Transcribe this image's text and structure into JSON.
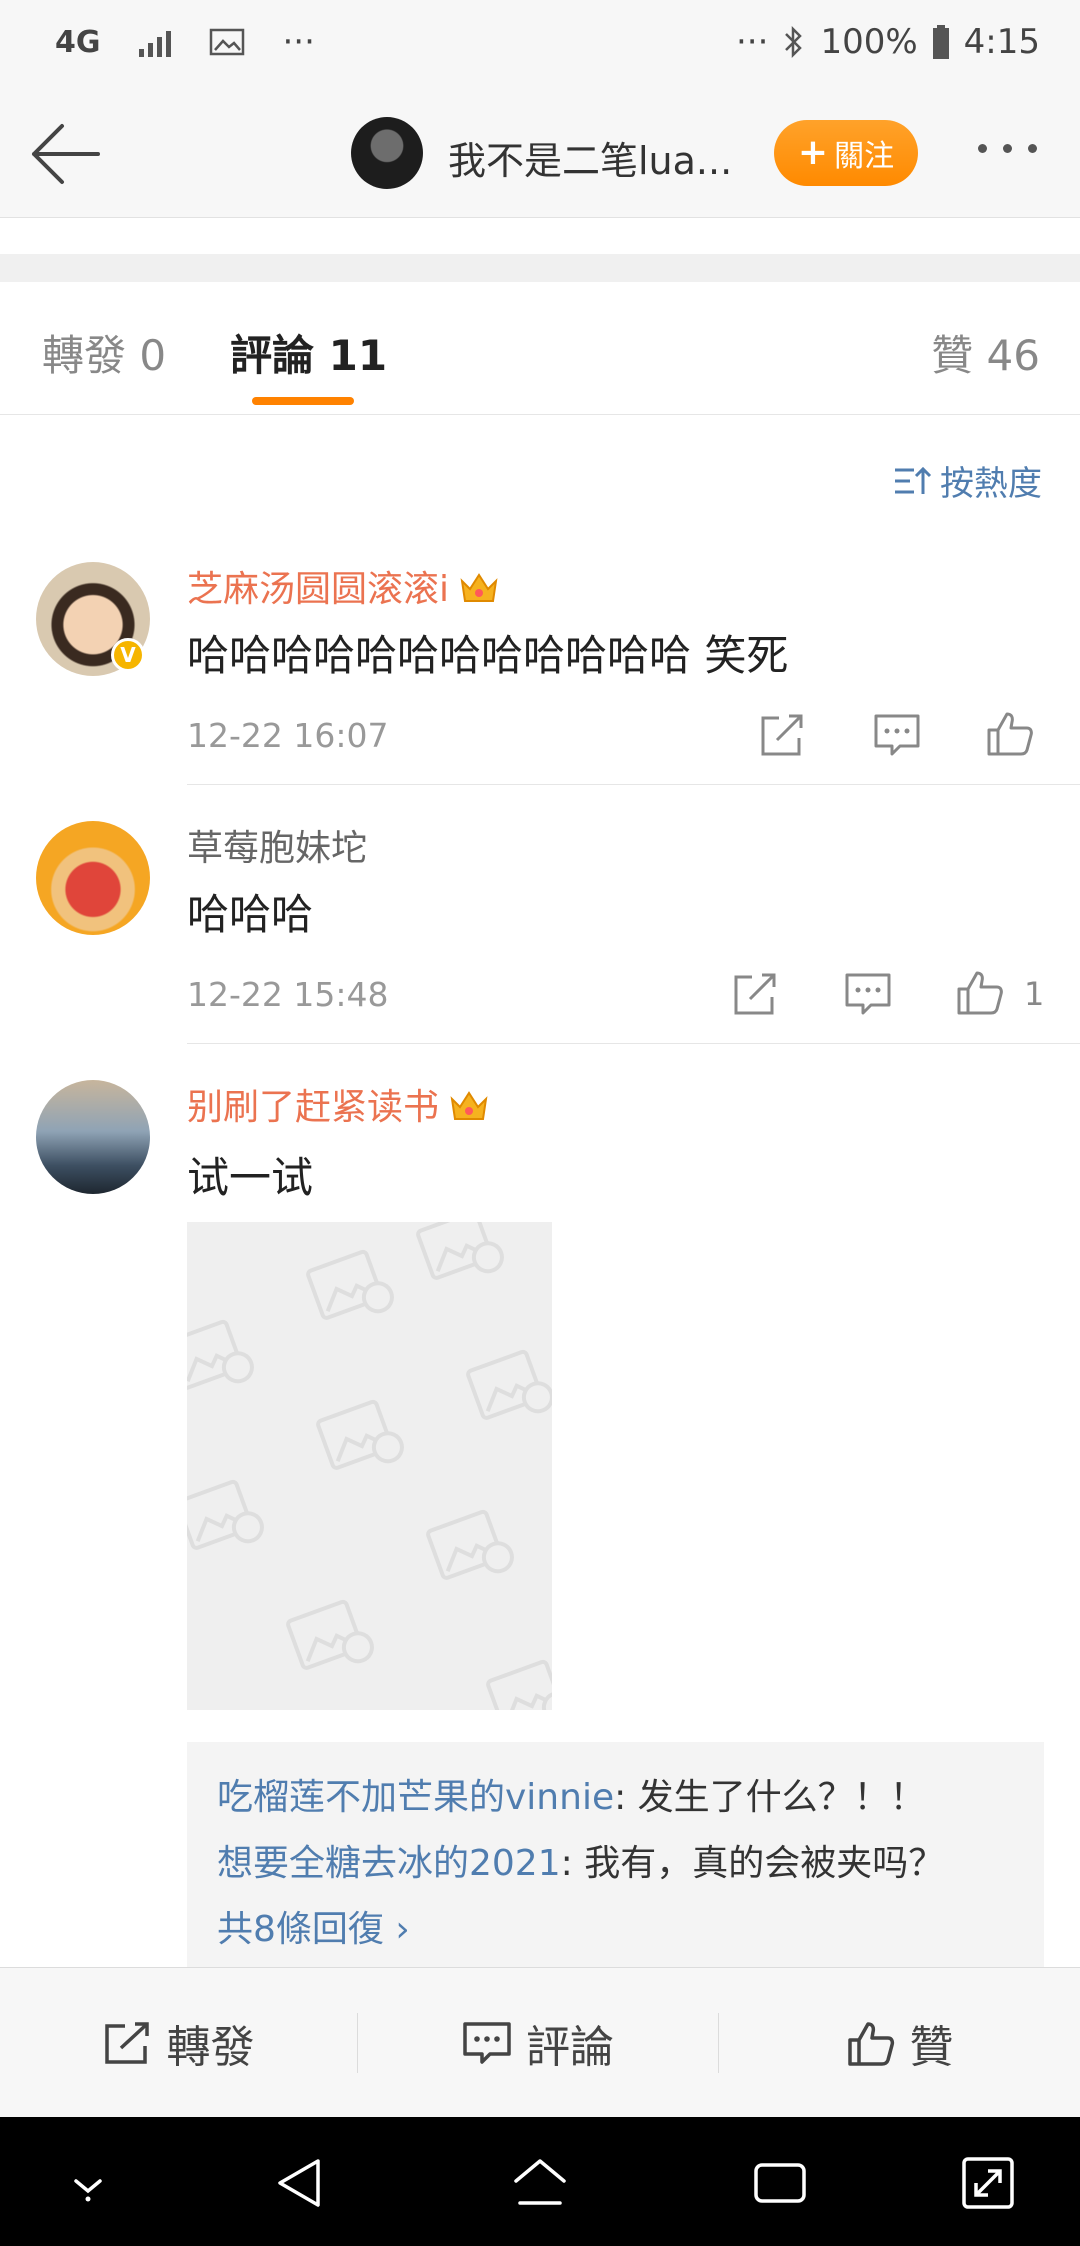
{
  "status_bar": {
    "network": "4G",
    "dots": "···",
    "battery": "100%",
    "time": "4:15"
  },
  "nav": {
    "title": "我不是二笔lua...",
    "follow_label": "關注"
  },
  "tabs": {
    "repost": "轉發 0",
    "comments": "評論 11",
    "likes": "贊 46"
  },
  "sort_label": "按熱度",
  "comments": [
    {
      "username": "芝麻汤圆圆滚滚i",
      "text": "哈哈哈哈哈哈哈哈哈哈哈哈 笑死",
      "time": "12-22 16:07",
      "likes": ""
    },
    {
      "username": "草莓胞妹坨",
      "text": "哈哈哈",
      "time": "12-22 15:48",
      "likes": "1"
    },
    {
      "username": "别刷了赶紧读书",
      "text": "试一试"
    }
  ],
  "replies": [
    {
      "user": "吃榴莲不加芒果的vinnie",
      "text": ": 发生了什么？！！"
    },
    {
      "user": "想要全糖去冰的2021",
      "text": ": 我有，真的会被夹吗？"
    }
  ],
  "replies_more": "共8條回復 ›",
  "bottom_bar": {
    "repost": "轉發",
    "comment": "評論",
    "like": "贊"
  }
}
